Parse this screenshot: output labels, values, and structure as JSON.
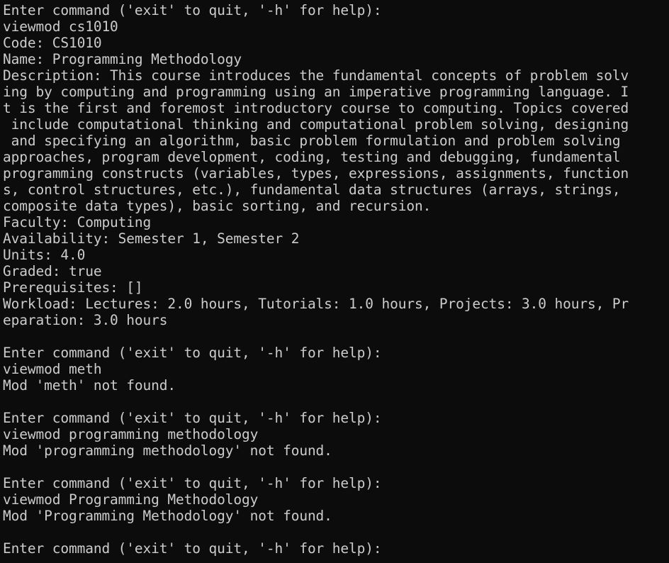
{
  "terminal": {
    "lines": [
      "Enter command ('exit' to quit, '-h' for help):",
      "viewmod cs1010",
      "Code: CS1010",
      "Name: Programming Methodology",
      "Description: This course introduces the fundamental concepts of problem solv",
      "ing by computing and programming using an imperative programming language. I",
      "t is the first and foremost introductory course to computing. Topics covered",
      " include computational thinking and computational problem solving, designing",
      " and specifying an algorithm, basic problem formulation and problem solving",
      "approaches, program development, coding, testing and debugging, fundamental",
      "programming constructs (variables, types, expressions, assignments, function",
      "s, control structures, etc.), fundamental data structures (arrays, strings,",
      "composite data types), basic sorting, and recursion.",
      "Faculty: Computing",
      "Availability: Semester 1, Semester 2",
      "Units: 4.0",
      "Graded: true",
      "Prerequisites: []",
      "Workload: Lectures: 2.0 hours, Tutorials: 1.0 hours, Projects: 3.0 hours, Pr",
      "eparation: 3.0 hours",
      "",
      "Enter command ('exit' to quit, '-h' for help):",
      "viewmod meth",
      "Mod 'meth' not found.",
      "",
      "Enter command ('exit' to quit, '-h' for help):",
      "viewmod programming methodology",
      "Mod 'programming methodology' not found.",
      "",
      "Enter command ('exit' to quit, '-h' for help):",
      "viewmod Programming Methodology",
      "Mod 'Programming Methodology' not found.",
      "",
      "Enter command ('exit' to quit, '-h' for help):"
    ]
  }
}
